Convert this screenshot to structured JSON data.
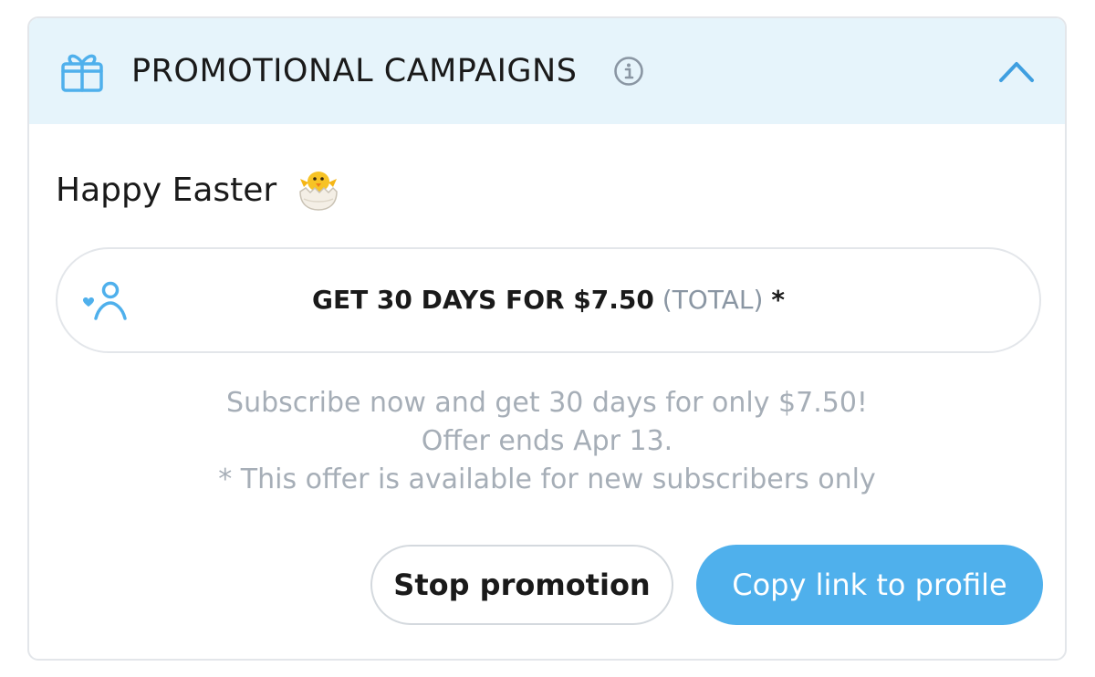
{
  "header": {
    "title": "PROMOTIONAL CAMPAIGNS",
    "icon": "gift-icon",
    "info_icon": "info-icon",
    "collapse_icon": "chevron-up-icon"
  },
  "campaign": {
    "title": "Happy Easter",
    "emoji_icon": "hatching-chick-icon"
  },
  "offer": {
    "icon": "subscriber-heart-icon",
    "main": "GET 30 DAYS FOR $7.50",
    "total": "(TOTAL)",
    "asterisk": "*"
  },
  "description": {
    "line1": "Subscribe now and get 30 days for only $7.50!",
    "line2": "Offer ends Apr 13.",
    "line3": "* This offer is available for new subscribers only"
  },
  "buttons": {
    "stop_label": "Stop promotion",
    "copy_label": "Copy link to profile"
  },
  "colors": {
    "accent": "#4fb0ec",
    "header_bg": "#e6f4fb",
    "muted_text": "#a6aeb7"
  }
}
